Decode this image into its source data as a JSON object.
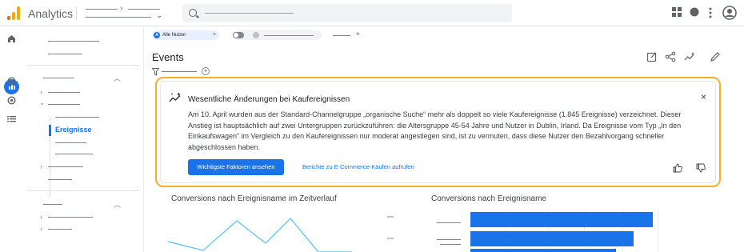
{
  "app": {
    "title": "Analytics"
  },
  "filter_chip": {
    "badge": "A",
    "label": "Alle Nutzer",
    "close": "×"
  },
  "page": {
    "title": "Events"
  },
  "nav": {
    "active_item": "Ereignisse"
  },
  "insight": {
    "title": "Wesentliche Änderungen bei Kaufereignissen",
    "body": "Am 10. April wurden aus der Standard-Channelgruppe „organische Suche“ mehr als doppelt so viele Kaufereignisse (1.845 Ereignisse) verzeichnet. Dieser Anstieg ist hauptsächlich auf zwei Untergruppen zurückzuführen: die Altersgruppe 45-54 Jahre und Nutzer in Dublin, Irland. Da Ereignisse vom Typ „In den Einkaufswagen“ im Vergleich zu den Kaufereignissen nur moderat angestiegen sind, ist zu vermuten, dass diese Nutzer den Bezahlvorgang schneller abgeschlossen haben.",
    "primary_button": "Wichtigste Faktoren ansehen",
    "link_button": "Berichte zu E-Commerce-Käufen aufrufen",
    "close": "×"
  },
  "charts": {
    "line_title": "Conversions nach Ereignisname im Zeitverlauf",
    "bar_title": "Conversions nach Ereignisname"
  },
  "colors": {
    "accent": "#1a73e8",
    "highlight_border": "#f6b026"
  },
  "icons": {
    "logo": "analytics-logo",
    "search": "search-icon",
    "apps": "apps-grid-icon",
    "account": "account-circle-icon"
  }
}
